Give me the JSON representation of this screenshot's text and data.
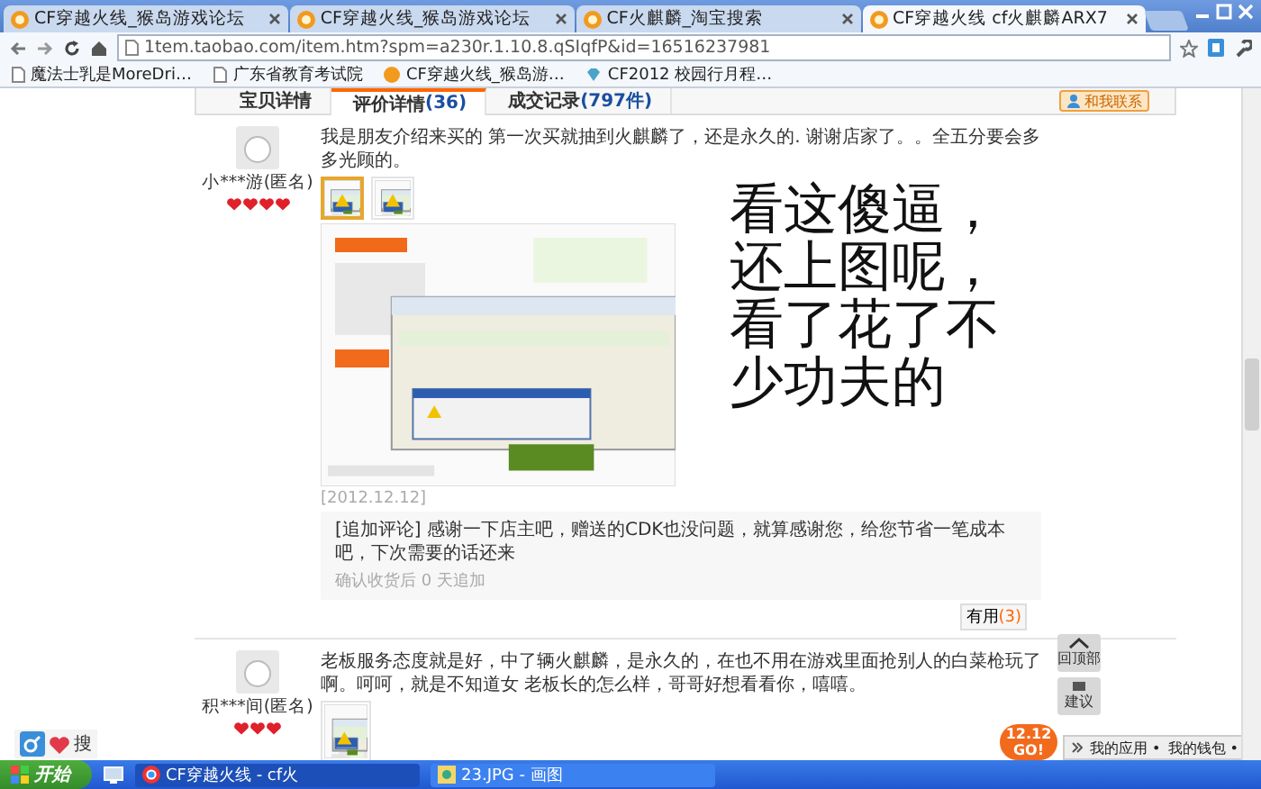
{
  "browser": {
    "tabs": [
      {
        "title": "CF穿越火线_猴岛游戏论坛",
        "selected": false
      },
      {
        "title": "CF穿越火线_猴岛游戏论坛",
        "selected": false
      },
      {
        "title": "CF火麒麟_淘宝搜索",
        "selected": false
      },
      {
        "title": "CF穿越火线 cf火麒麟ARX7",
        "selected": true
      }
    ],
    "address": "1tem.taobao.com/item.htm?spm=a230r.1.10.8.qSIqfP&id=16516237981",
    "bookmarks": [
      {
        "label": "魔法士乳是MoreDri…"
      },
      {
        "label": "广东省教育考试院"
      },
      {
        "label": "CF穿越火线_猴岛游…"
      },
      {
        "label": "CF2012 校园行月程…"
      }
    ]
  },
  "page": {
    "tabs": [
      {
        "label": "宝贝详情",
        "selected": false
      },
      {
        "label": "评价详情",
        "count": "(36)",
        "selected": true
      },
      {
        "label": "成交记录",
        "count": "(797件)",
        "selected": false
      }
    ],
    "contact": "和我联系",
    "reviews": [
      {
        "user": "小***游(匿名)",
        "stars": 4,
        "text": "我是朋友介绍来买的 第一次买就抽到火麒麟了，还是永久的. 谢谢店家了。。全五分要会多多光顾的。",
        "photos": [
          {
            "selected": true
          },
          {
            "selected": false
          }
        ],
        "date": "[2012.12.12]",
        "appended": {
          "text": "[追加评论] 感谢一下店主吧，赠送的CDK也没问题，就算感谢您，给您节省一笔成本吧，下次需要的话还来",
          "note": "确认收货后 0 天追加"
        },
        "useful": {
          "label": "有用",
          "count": "(3)"
        }
      },
      {
        "user": "积***间(匿名)",
        "stars": 3,
        "text": "老板服务态度就是好，中了辆火麒麟，是永久的，在也不用在游戏里面抢别人的白菜枪玩了啊。呵呵，就是不知道女 老板长的怎么样，哥哥好想看看你，嘻嘻。",
        "photos": [
          {
            "selected": false
          }
        ]
      }
    ],
    "annotation": [
      "看这傻逼，",
      "还上图呢，",
      "看了花了不",
      "少功夫的"
    ],
    "side_buttons": [
      {
        "kind": "top",
        "label": "回顶部"
      },
      {
        "kind": "advice",
        "label": "建议"
      }
    ],
    "search_label": "搜",
    "promo": {
      "date": "12.12",
      "go": "GO!",
      "links": [
        "我的应用 •",
        "我的钱包 •"
      ]
    }
  },
  "taskbar": {
    "start": "开始",
    "items": [
      {
        "label": "CF穿越火线 - cf火",
        "selected": true
      },
      {
        "label": "23.JPG - 画图",
        "selected": false
      }
    ]
  }
}
